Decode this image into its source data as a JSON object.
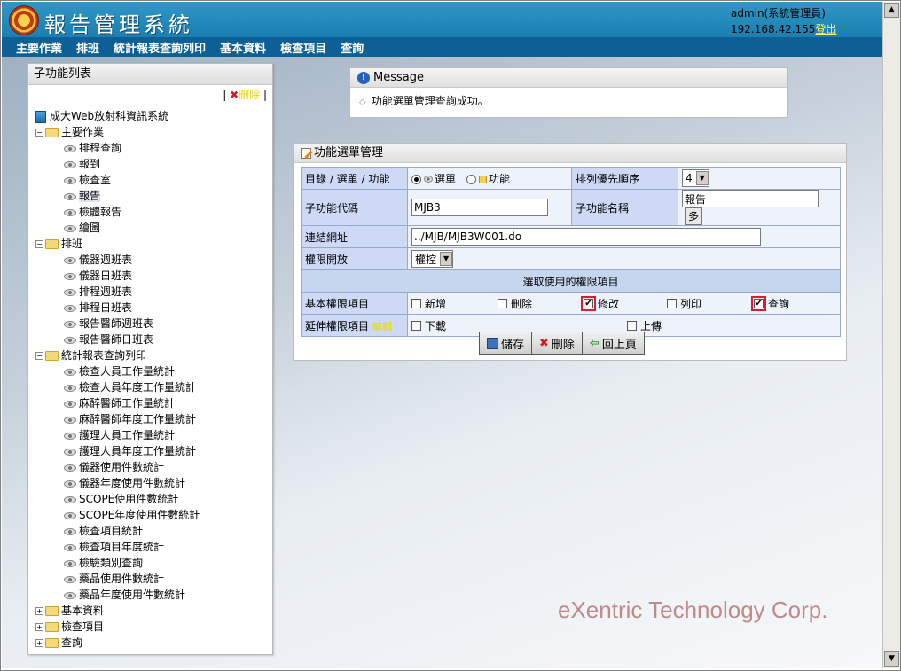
{
  "app": {
    "title": "報告管理系統",
    "user": "admin(系統管理員)",
    "ip": "192.168.42.155",
    "logout": "登出"
  },
  "menu": [
    "主要作業",
    "排班",
    "統計報表查詢列印",
    "基本資料",
    "檢查項目",
    "查詢"
  ],
  "sidebar": {
    "title": "子功能列表",
    "delete_label": "刪除",
    "root": "成大Web放射科資訊系統",
    "groups": [
      {
        "label": "主要作業",
        "items": [
          "排程查詢",
          "報到",
          "檢查室",
          "報告",
          "檢體報告",
          "繪圖"
        ]
      },
      {
        "label": "排班",
        "items": [
          "儀器週班表",
          "儀器日班表",
          "排程週班表",
          "排程日班表",
          "報告醫師週班表",
          "報告醫師日班表"
        ]
      },
      {
        "label": "統計報表查詢列印",
        "items": [
          "檢查人員工作量統計",
          "檢查人員年度工作量統計",
          "麻醉醫師工作量統計",
          "麻醉醫師年度工作量統計",
          "護理人員工作量統計",
          "護理人員年度工作量統計",
          "儀器使用件數統計",
          "儀器年度使用件數統計",
          "SCOPE使用件數統計",
          "SCOPE年度使用件數統計",
          "檢查項目統計",
          "檢查項目年度統計",
          "檢驗類別查詢",
          "藥品使用件數統計",
          "藥品年度使用件數統計"
        ]
      }
    ],
    "collapsed": [
      "基本資料",
      "檢查項目",
      "查詢"
    ]
  },
  "message": {
    "title": "Message",
    "text": "功能選單管理查詢成功。"
  },
  "form": {
    "title": "功能選單管理",
    "type_label": "目錄 / 選單 / 功能",
    "type_menu": "選單",
    "type_function": "功能",
    "order_label": "排列優先順序",
    "order_value": "4",
    "code_label": "子功能代碼",
    "code_value": "MJB3",
    "name_label": "子功能名稱",
    "name_value": "報告",
    "more_label": "多",
    "url_label": "連結網址",
    "url_value": "../MJB/MJB3W001.do",
    "access_label": "權限開放",
    "access_value": "權控",
    "section_title": "選取使用的權限項目",
    "basic_label": "基本權限項目",
    "basic_items": [
      {
        "label": "新增",
        "checked": false
      },
      {
        "label": "刪除",
        "checked": false
      },
      {
        "label": "修改",
        "checked": true
      },
      {
        "label": "列印",
        "checked": false
      },
      {
        "label": "查詢",
        "checked": true
      }
    ],
    "ext_label": "延伸權限項目",
    "ext_tag": "編輯",
    "ext_items": [
      {
        "label": "下載",
        "checked": false
      },
      {
        "label": "上傳",
        "checked": false
      }
    ],
    "buttons": {
      "save": "儲存",
      "delete": "刪除",
      "back": "回上頁"
    }
  },
  "watermark": "eXentric Technology Corp."
}
